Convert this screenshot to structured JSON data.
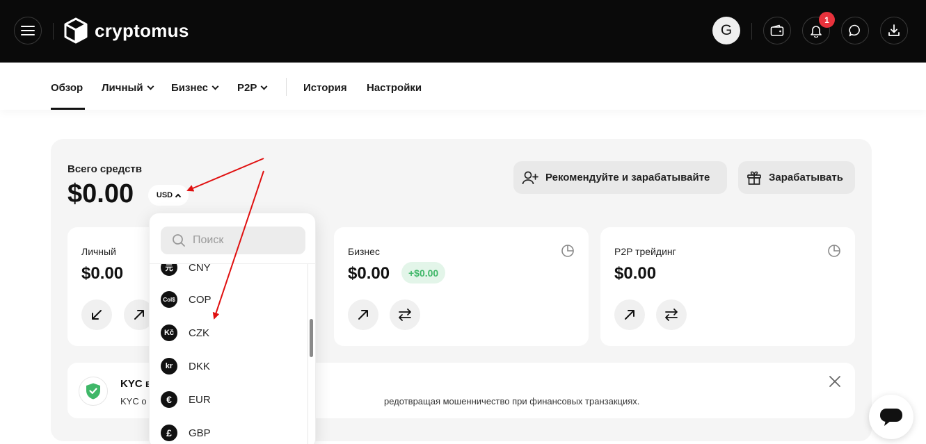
{
  "header": {
    "logo_text": "cryptomus",
    "avatar_letter": "G",
    "notification_count": "1"
  },
  "nav": {
    "items": [
      {
        "label": "Обзор",
        "dropdown": false,
        "active": true
      },
      {
        "label": "Личный",
        "dropdown": true
      },
      {
        "label": "Бизнес",
        "dropdown": true
      },
      {
        "label": "P2P",
        "dropdown": true
      },
      {
        "label": "История",
        "dropdown": false
      },
      {
        "label": "Настройки",
        "dropdown": false
      }
    ]
  },
  "overview": {
    "total_label": "Всего средств",
    "total_value": "$0.00",
    "currency": "USD",
    "refer_label": "Рекомендуйте и зарабатывайте",
    "earn_label": "Зарабатывать"
  },
  "cards": {
    "personal": {
      "title": "Личный",
      "value": "$0.00"
    },
    "business": {
      "title": "Бизнес",
      "value": "$0.00",
      "gain": "+$0.00"
    },
    "p2p": {
      "title": "P2P трейдинг",
      "value": "$0.00"
    }
  },
  "kyc": {
    "title": "KYC в",
    "desc": "KYC о",
    "desc_tail": "редотвращая мошенничество при финансовых транзакциях."
  },
  "dropdown": {
    "search_placeholder": "Поиск",
    "items": [
      {
        "code": "CNY",
        "glyph": "元"
      },
      {
        "code": "COP",
        "glyph": "Col$"
      },
      {
        "code": "CZK",
        "glyph": "Kč"
      },
      {
        "code": "DKK",
        "glyph": "kr"
      },
      {
        "code": "EUR",
        "glyph": "€"
      },
      {
        "code": "GBP",
        "glyph": "£"
      }
    ]
  },
  "colors": {
    "topbar": "#0a0a0a",
    "badge": "#e8323c",
    "gain": "#3fb768",
    "annotation_arrow": "#e01010"
  }
}
